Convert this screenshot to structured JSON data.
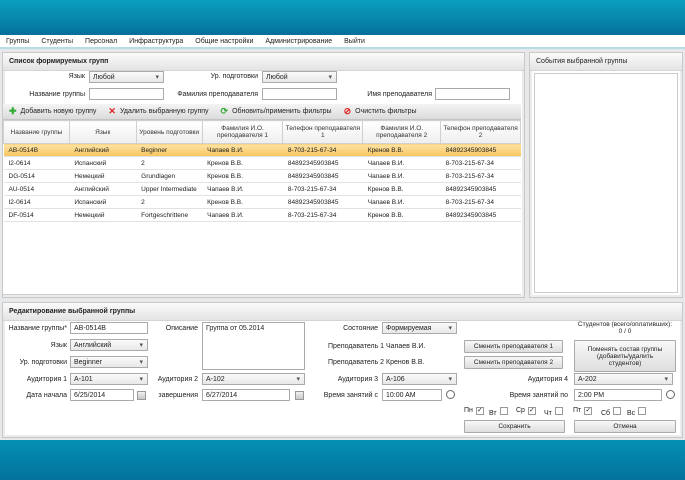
{
  "menu": [
    "Группы",
    "Студенты",
    "Персонал",
    "Инфраструктура",
    "Общие настройки",
    "Администрирование",
    "Выйти"
  ],
  "groups_panel": {
    "title": "Список формируемых групп",
    "filters": {
      "lang_label": "Язык",
      "lang_value": "Любой",
      "level_label": "Ур. подготовки",
      "level_value": "Любой",
      "name_label": "Название группы",
      "name_value": "",
      "teacher_surname_label": "Фамилия преподавателя",
      "teacher_surname_value": "",
      "teacher_name_label": "Имя преподавателя",
      "teacher_name_value": ""
    },
    "toolbar": {
      "add": "Добавить новую группу",
      "delete": "Удалить выбранную группу",
      "refresh": "Обновить/применить фильтры",
      "clear": "Очистить фильтры"
    },
    "columns": [
      "Название группы",
      "Язык",
      "Уровень подготовки",
      "Фамилия И.О. преподавателя 1",
      "Телефон преподавателя 1",
      "Фамилия И.О. преподавателя 2",
      "Телефон преподавателя 2"
    ],
    "rows": [
      [
        "AB-0514B",
        "Английский",
        "Beginner",
        "Чапаев В.И.",
        "8-703-215-67-34",
        "Кренов В.В.",
        "84892345903845"
      ],
      [
        "I2-0614",
        "Испанский",
        "2",
        "Кренов В.В.",
        "84892345903845",
        "Чапаев В.И.",
        "8-703-215-67-34"
      ],
      [
        "DG-0514",
        "Немецкий",
        "Grundlagen",
        "Кренов В.В.",
        "84892345903845",
        "Чапаев В.И.",
        "8-703-215-67-34"
      ],
      [
        "AU-0514",
        "Английский",
        "Upper Intermediate",
        "Чапаев В.И.",
        "8-703-215-67-34",
        "Кренов В.В.",
        "84892345903845"
      ],
      [
        "I2-0614",
        "Испанский",
        "2",
        "Кренов В.В.",
        "84892345903845",
        "Чапаев В.И.",
        "8-703-215-67-34"
      ],
      [
        "DF-0514",
        "Немецкий",
        "Fortgeschrittene",
        "Чапаев В.И.",
        "8-703-215-67-34",
        "Кренов В.В.",
        "84892345903845"
      ]
    ],
    "selected_row": 0
  },
  "events_panel": {
    "title": "События выбранной группы"
  },
  "edit": {
    "title": "Редактирование выбранной группы",
    "name_label": "Название группы*",
    "name_value": "AB-0514B",
    "lang_label": "Язык",
    "lang_value": "Английский",
    "level_label": "Ур. подготовки",
    "level_value": "Beginner",
    "room1_label": "Аудитория 1",
    "room1_value": "A-101",
    "start_label": "Дата начала",
    "start_value": "6/25/2014",
    "desc_label": "Описание",
    "desc_value": "Группа от 05.2014",
    "room2_label": "Аудитория 2",
    "room2_value": "A-102",
    "end_label": "завершения",
    "end_value": "6/27/2014",
    "state_label": "Состояние",
    "state_value": "Формируемая",
    "t1_label": "Преподаватель 1",
    "t1_value": "Чапаев В.И.",
    "t2_label": "Преподаватель 2",
    "t2_value": "Кренов В.В.",
    "room3_label": "Аудитория 3",
    "room3_value": "A-106",
    "time_from_label": "Время занятий с",
    "time_from_value": "10:00 AM",
    "change_t1": "Сменить преподавателя 1",
    "change_t2": "Сменить преподавателя 2",
    "students_label": "Студентов (всего/оплативших):",
    "students_value": "0 / 0",
    "change_students": "Поменять состав группы (добавить/удалить студентов)",
    "room4_label": "Аудитория 4",
    "room4_value": "A-202",
    "time_to_label": "Время занятий по",
    "time_to_value": "2:00 PM",
    "days": [
      {
        "label": "Пн",
        "checked": true
      },
      {
        "label": "Вт",
        "checked": false
      },
      {
        "label": "Ср",
        "checked": true
      },
      {
        "label": "Чт",
        "checked": false
      },
      {
        "label": "Пт",
        "checked": true
      },
      {
        "label": "Сб",
        "checked": false
      },
      {
        "label": "Вс",
        "checked": false
      }
    ],
    "save": "Сохранить",
    "cancel": "Отмена"
  }
}
